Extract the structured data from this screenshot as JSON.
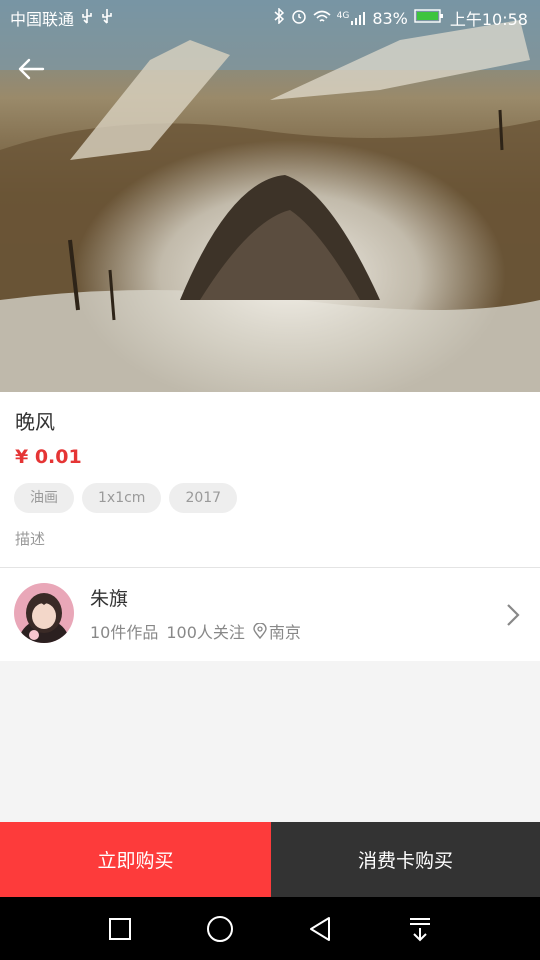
{
  "status_bar": {
    "carrier": "中国联通",
    "usb_icons": [
      "usb-icon",
      "usb-icon"
    ],
    "battery": "83%",
    "time": "上午10:58",
    "network": "4G"
  },
  "header": {
    "back_icon": "arrow-left-icon"
  },
  "artwork": {
    "title": "晚风",
    "price": "¥ 0.01",
    "tags": [
      "油画",
      "1x1cm",
      "2017"
    ],
    "description_label": "描述"
  },
  "artist": {
    "name": "朱旗",
    "works": "10件作品",
    "followers": "100人关注",
    "location": "南京"
  },
  "actions": {
    "buy_now": "立即购买",
    "buy_with_card": "消费卡购买"
  },
  "colors": {
    "accent_red": "#fd3b3b",
    "price_red": "#e53535",
    "dark_button": "#333333"
  }
}
